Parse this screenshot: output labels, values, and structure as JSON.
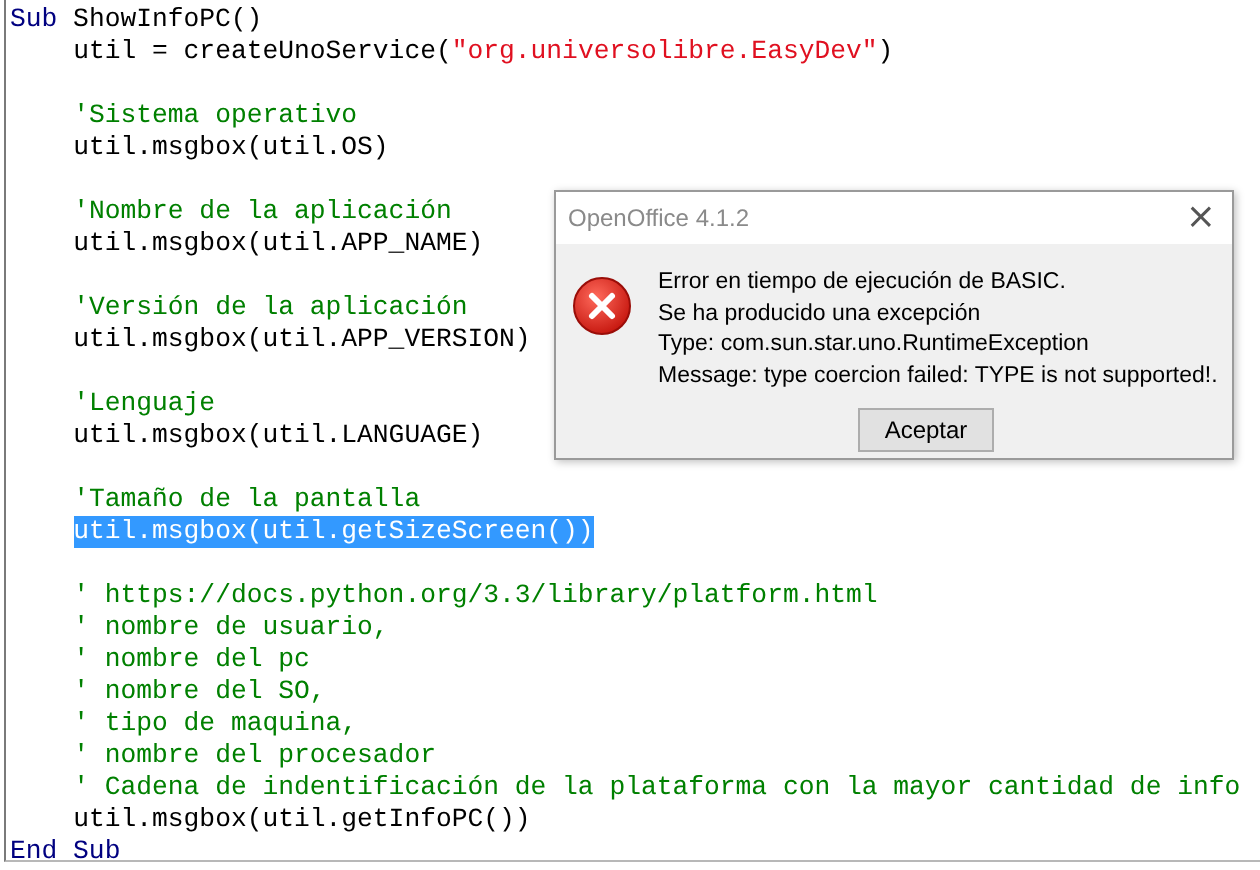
{
  "editor": {
    "blocks": [
      {
        "lines": [
          {
            "indented": false,
            "selected": false,
            "tokens": [
              {
                "kind": "keyword",
                "text": "Sub"
              },
              {
                "kind": "plain",
                "text": " ShowInfoPC()"
              }
            ]
          },
          {
            "indented": true,
            "selected": false,
            "tokens": [
              {
                "kind": "plain",
                "text": "util = createUnoService("
              },
              {
                "kind": "string",
                "text": "\"org.universolibre.EasyDev\""
              },
              {
                "kind": "plain",
                "text": ")"
              }
            ]
          }
        ]
      },
      {
        "lines": [
          {
            "indented": true,
            "selected": false,
            "tokens": [
              {
                "kind": "comment",
                "text": "'Sistema operativo"
              }
            ]
          },
          {
            "indented": true,
            "selected": false,
            "tokens": [
              {
                "kind": "plain",
                "text": "util.msgbox(util.OS)"
              }
            ]
          }
        ]
      },
      {
        "lines": [
          {
            "indented": true,
            "selected": false,
            "tokens": [
              {
                "kind": "comment",
                "text": "'Nombre de la aplicación"
              }
            ]
          },
          {
            "indented": true,
            "selected": false,
            "tokens": [
              {
                "kind": "plain",
                "text": "util.msgbox(util.APP_NAME)"
              }
            ]
          }
        ]
      },
      {
        "lines": [
          {
            "indented": true,
            "selected": false,
            "tokens": [
              {
                "kind": "comment",
                "text": "'Versión de la aplicación"
              }
            ]
          },
          {
            "indented": true,
            "selected": false,
            "tokens": [
              {
                "kind": "plain",
                "text": "util.msgbox(util.APP_VERSION)"
              }
            ]
          }
        ]
      },
      {
        "lines": [
          {
            "indented": true,
            "selected": false,
            "tokens": [
              {
                "kind": "comment",
                "text": "'Lenguaje"
              }
            ]
          },
          {
            "indented": true,
            "selected": false,
            "tokens": [
              {
                "kind": "plain",
                "text": "util.msgbox(util.LANGUAGE)"
              }
            ]
          }
        ]
      },
      {
        "lines": [
          {
            "indented": true,
            "selected": false,
            "tokens": [
              {
                "kind": "comment",
                "text": "'Tamaño de la pantalla"
              }
            ]
          },
          {
            "indented": true,
            "selected": true,
            "tokens": [
              {
                "kind": "plain",
                "text": "util.msgbox(util.getSizeScreen())"
              }
            ]
          }
        ]
      },
      {
        "lines": [
          {
            "indented": true,
            "selected": false,
            "tokens": [
              {
                "kind": "comment",
                "text": "' https://docs.python.org/3.3/library/platform.html"
              }
            ]
          },
          {
            "indented": true,
            "selected": false,
            "tokens": [
              {
                "kind": "comment",
                "text": "' nombre de usuario,"
              }
            ]
          },
          {
            "indented": true,
            "selected": false,
            "tokens": [
              {
                "kind": "comment",
                "text": "' nombre del pc"
              }
            ]
          },
          {
            "indented": true,
            "selected": false,
            "tokens": [
              {
                "kind": "comment",
                "text": "' nombre del SO,"
              }
            ]
          },
          {
            "indented": true,
            "selected": false,
            "tokens": [
              {
                "kind": "comment",
                "text": "' tipo de maquina,"
              }
            ]
          },
          {
            "indented": true,
            "selected": false,
            "tokens": [
              {
                "kind": "comment",
                "text": "' nombre del procesador"
              }
            ]
          },
          {
            "indented": true,
            "selected": false,
            "tokens": [
              {
                "kind": "comment",
                "text": "' Cadena de indentificación de la plataforma con la mayor cantidad de info"
              }
            ]
          },
          {
            "indented": true,
            "selected": false,
            "tokens": [
              {
                "kind": "plain",
                "text": "util.msgbox(util.getInfoPC())"
              }
            ]
          },
          {
            "indented": false,
            "selected": false,
            "tokens": [
              {
                "kind": "keyword",
                "text": "End Sub"
              }
            ]
          }
        ]
      }
    ]
  },
  "dialog": {
    "title": "OpenOffice 4.1.2",
    "close": "×",
    "message_lines": [
      "Error en tiempo de ejecución de BASIC.",
      "Se ha producido una excepción",
      "Type: com.sun.star.uno.RuntimeException",
      "Message: type coercion failed: TYPE is not supported!."
    ],
    "buttons": [
      "Aceptar"
    ]
  }
}
